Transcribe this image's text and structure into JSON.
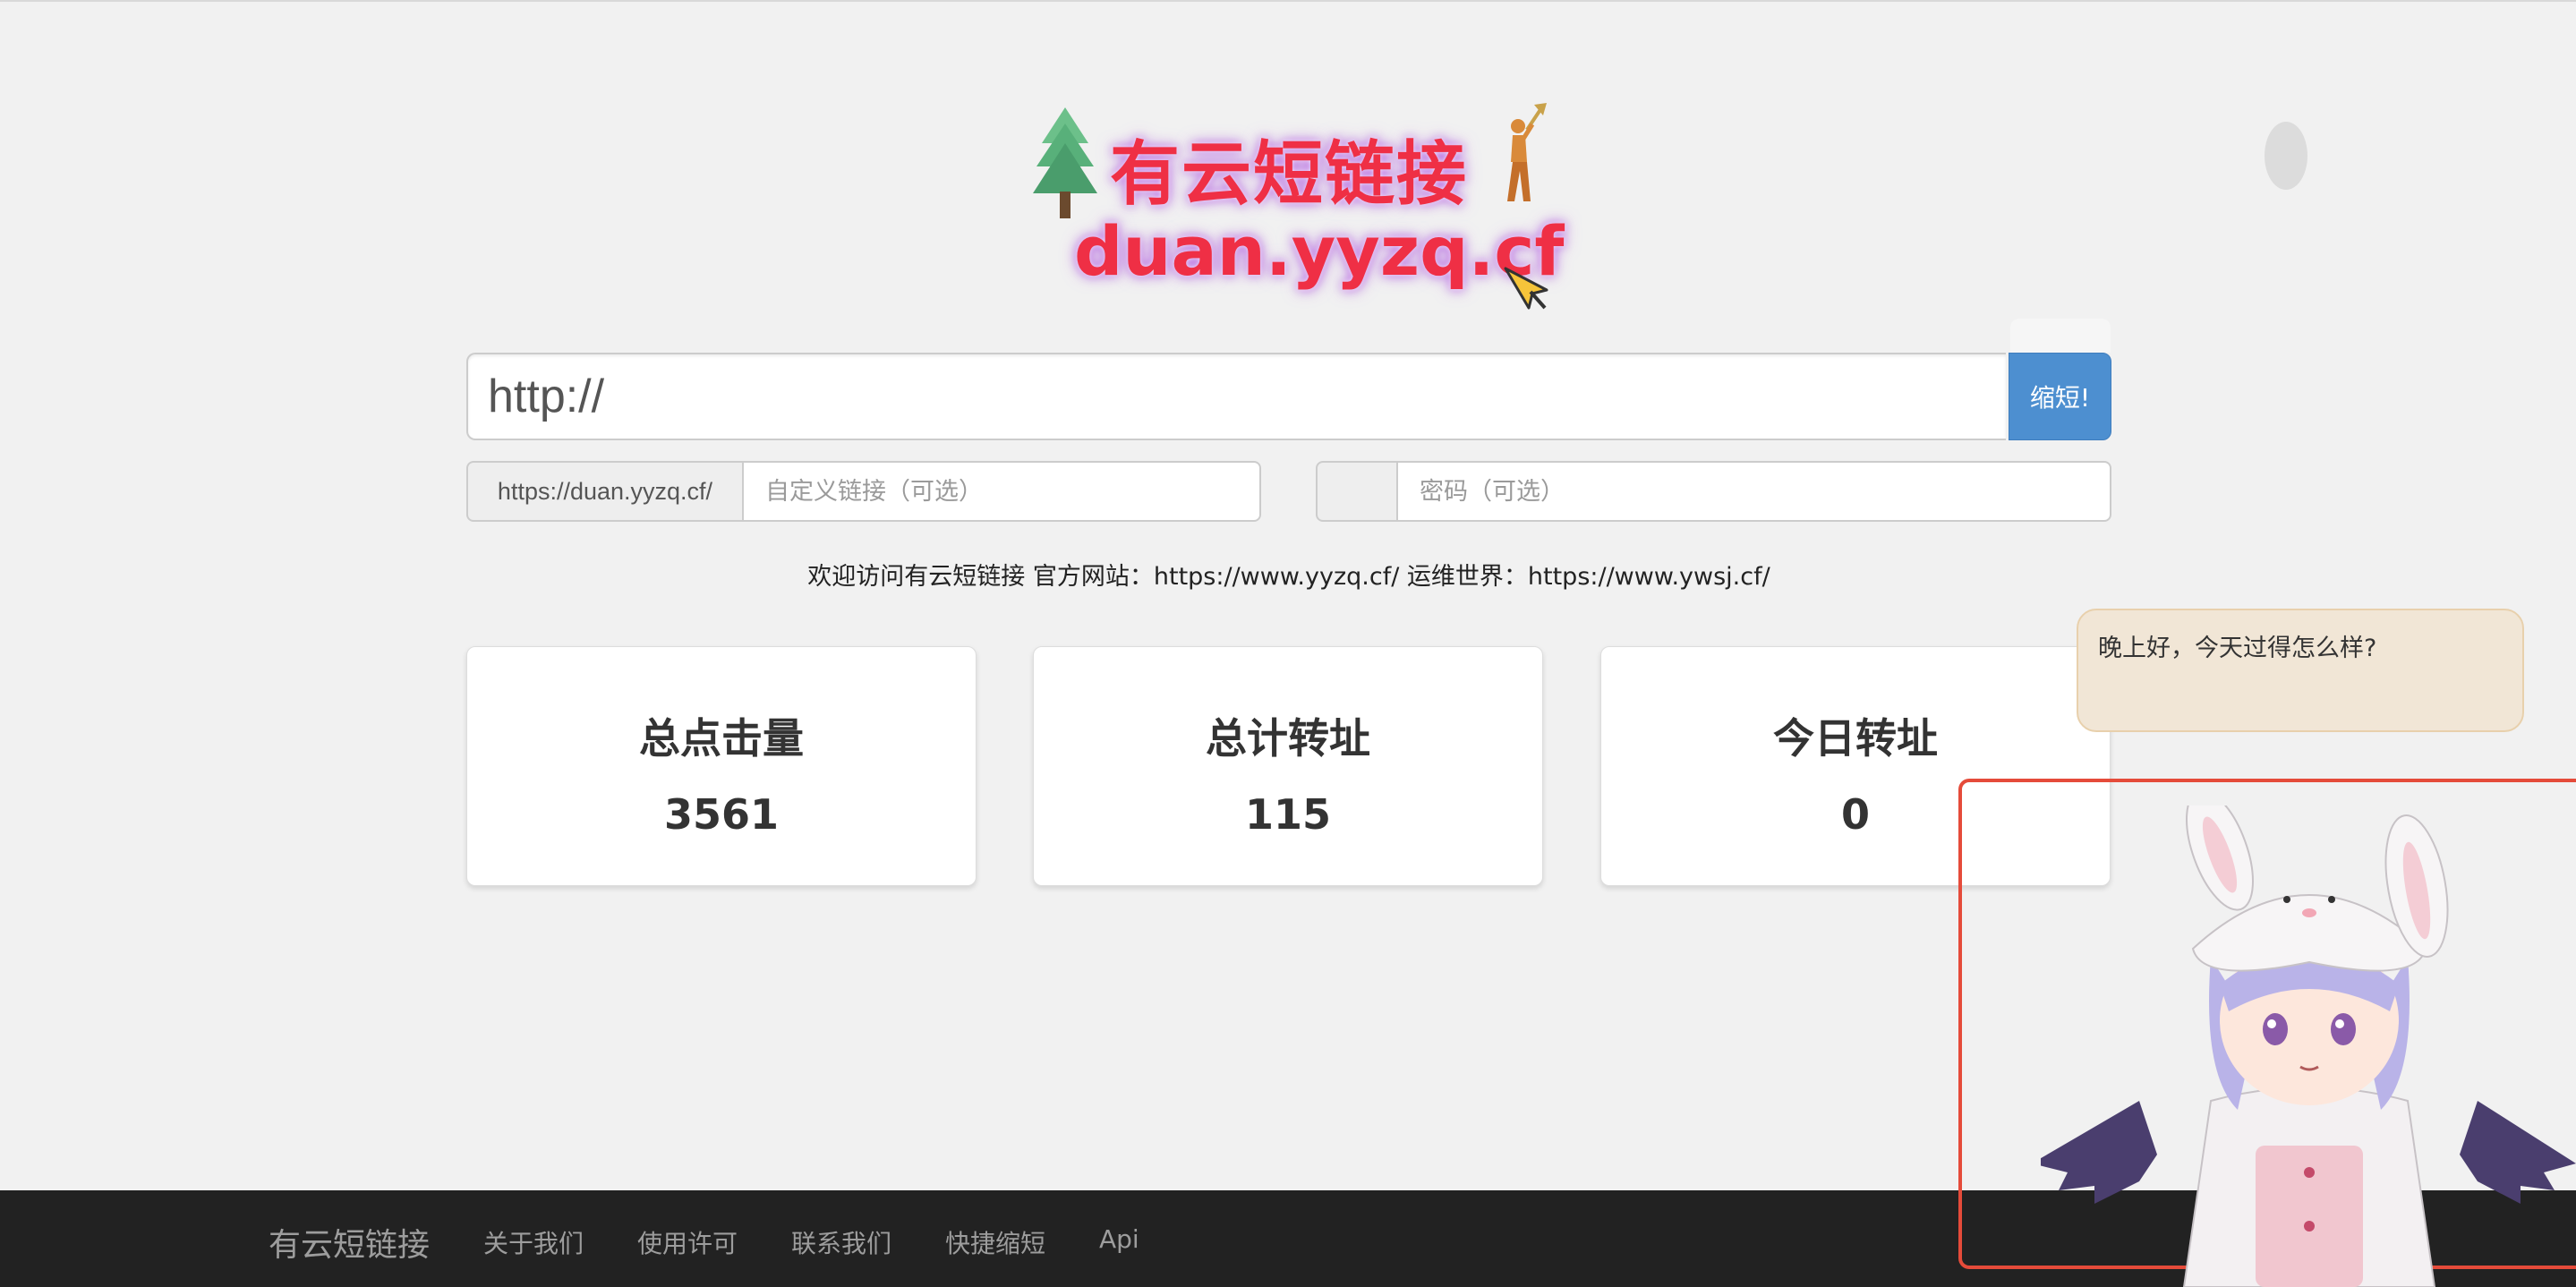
{
  "header": {
    "title": "有云短链接",
    "domain": "duan.yyzq.cf"
  },
  "shorten": {
    "url_placeholder": "http://",
    "button_label": "缩短!"
  },
  "custom": {
    "prefix": "https://duan.yyzq.cf/",
    "placeholder": "自定义链接（可选）"
  },
  "password": {
    "placeholder": "密码（可选）"
  },
  "welcome_text": "欢迎访问有云短链接 官方网站：https://www.yyzq.cf/ 运维世界：https://www.ywsj.cf/",
  "stats": [
    {
      "label": "总点击量",
      "value": "3561"
    },
    {
      "label": "总计转址",
      "value": "115"
    },
    {
      "label": "今日转址",
      "value": "0"
    }
  ],
  "footer": {
    "brand": "有云短链接",
    "links": [
      "关于我们",
      "使用许可",
      "联系我们",
      "快捷缩短",
      "Api"
    ]
  },
  "mascot": {
    "greeting": "晚上好，今天过得怎么样?"
  },
  "colors": {
    "brand_red": "#ef2f45",
    "button_blue": "#4d8fd0",
    "footer_bg": "#222222",
    "frame_red": "#e54b3a"
  }
}
